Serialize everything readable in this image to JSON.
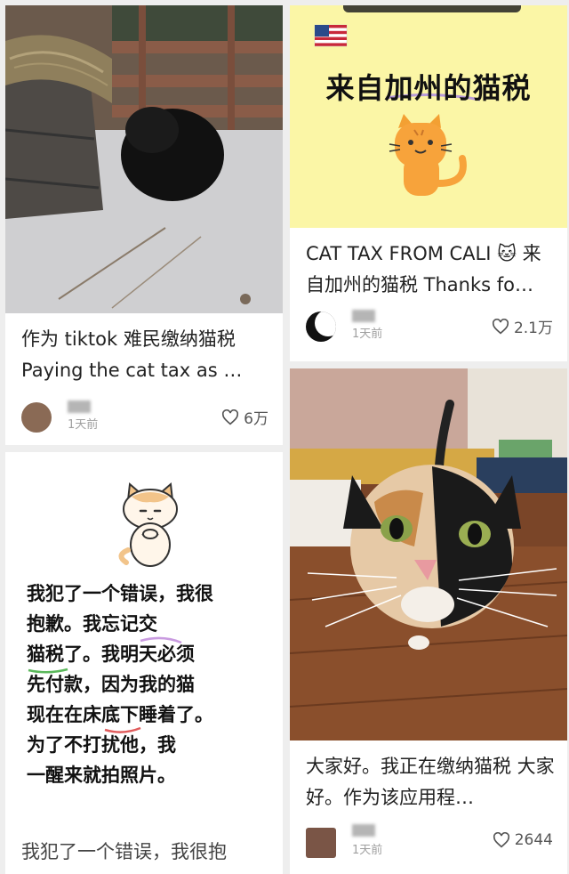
{
  "cards": [
    {
      "title": "作为 tiktok 难民缴纳猫税 Paying the cat tax as …",
      "time": "1天前",
      "likes": "6万"
    },
    {
      "image_heading": "来自加州的猫税",
      "title": "CAT TAX FROM CALI 🐱 来自加州的猫税 Thanks fo…",
      "time": "1天前",
      "likes": "2.1万"
    },
    {
      "note_lines": [
        "我犯了一个错误，我很",
        "抱歉。我忘记交",
        "猫税了。我明天必须",
        "先付款，因为我的猫",
        "现在在床底下睡着了。",
        "为了不打扰他，我",
        "一醒来就拍照片。"
      ],
      "title": "我犯了一个错误，我很抱"
    },
    {
      "title": "大家好。我正在缴纳猫税 大家好。作为该应用程…",
      "time": "1天前",
      "likes": "2644"
    }
  ]
}
